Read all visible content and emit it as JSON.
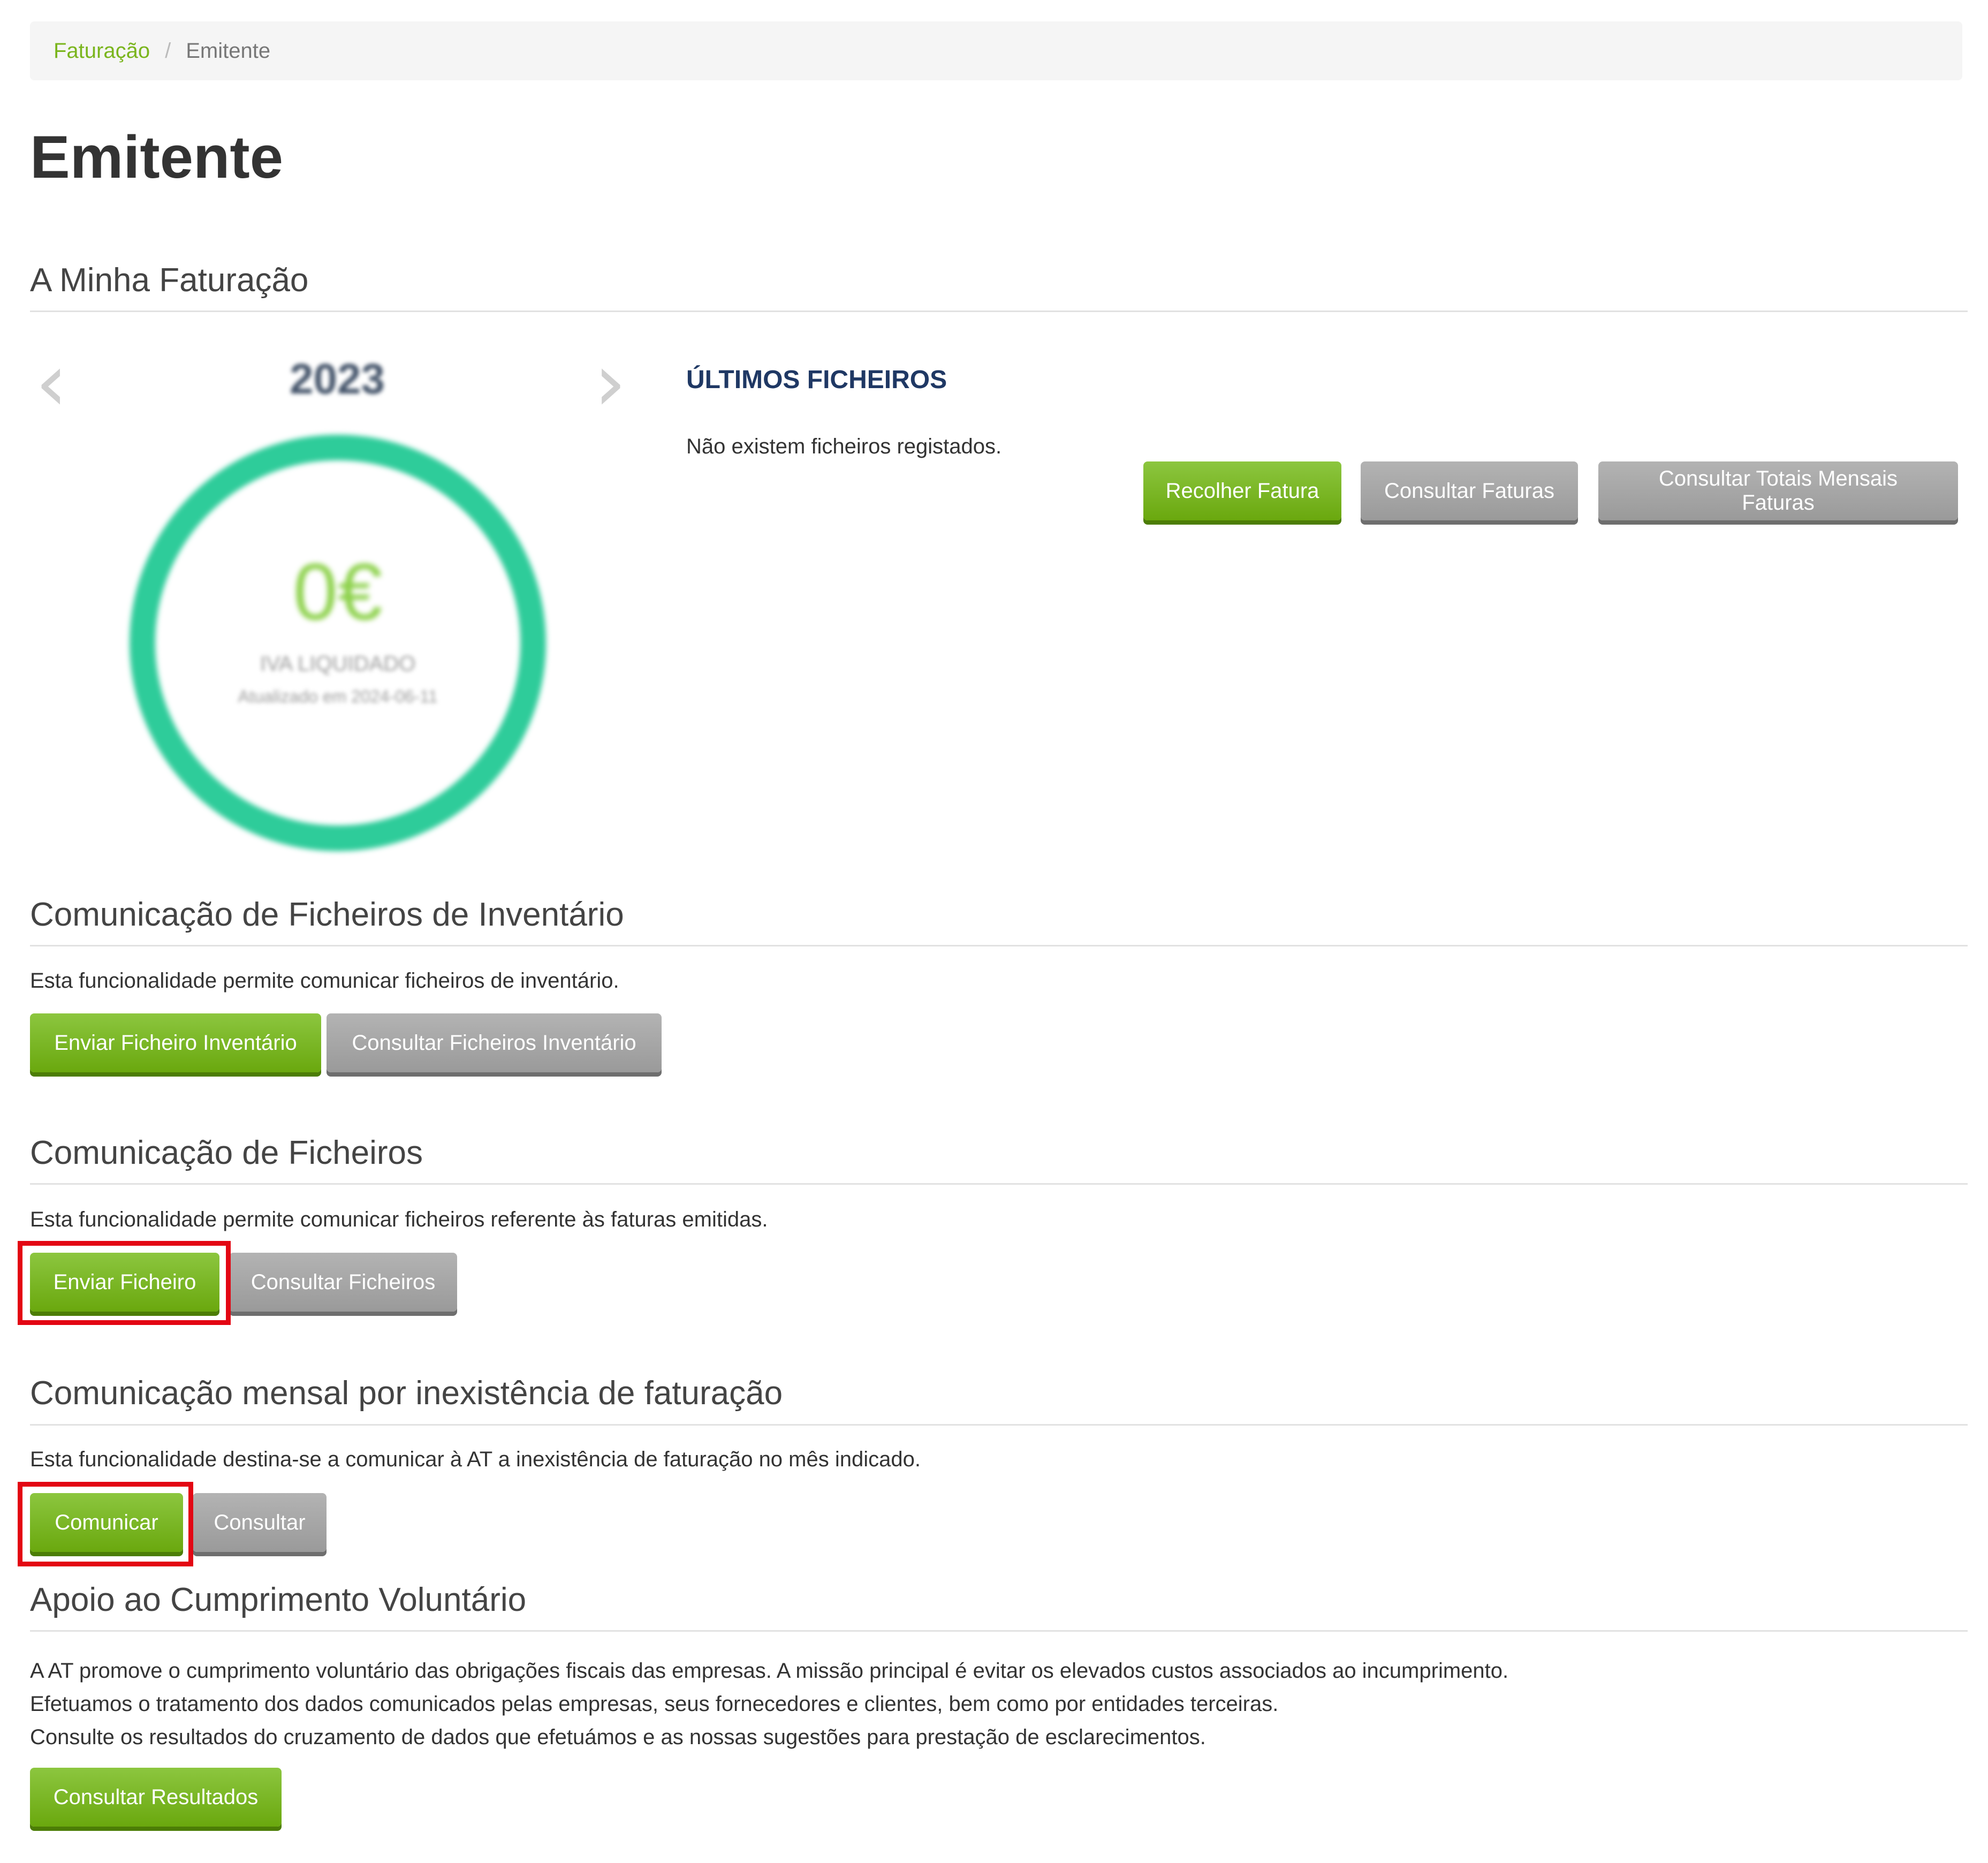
{
  "breadcrumb": {
    "link": "Faturação",
    "separator": "/",
    "current": "Emitente"
  },
  "page_title": "Emitente",
  "minha_faturacao": {
    "title": "A Minha Faturação",
    "year": "2023",
    "value": "0€",
    "label": "IVA LIQUIDADO",
    "updated": "Atualizado em 2024-06-11",
    "files_heading": "ÚLTIMOS FICHEIROS",
    "files_empty": "Não existem ficheiros registados.",
    "buttons": {
      "recolher": "Recolher Fatura",
      "consultar": "Consultar Faturas",
      "totais": "Consultar Totais Mensais Faturas"
    }
  },
  "inventario": {
    "title": "Comunicação de Ficheiros de Inventário",
    "description": "Esta funcionalidade permite comunicar ficheiros de inventário.",
    "buttons": {
      "enviar": "Enviar Ficheiro Inventário",
      "consultar": "Consultar Ficheiros Inventário"
    }
  },
  "ficheiros": {
    "title": "Comunicação de Ficheiros",
    "description": "Esta funcionalidade permite comunicar ficheiros referente às faturas emitidas.",
    "buttons": {
      "enviar": "Enviar Ficheiro",
      "consultar": "Consultar Ficheiros"
    }
  },
  "inexistencia": {
    "title": "Comunicação mensal por inexistência de faturação",
    "description": "Esta funcionalidade destina-se a comunicar à AT a inexistência de faturação no mês indicado.",
    "buttons": {
      "comunicar": "Comunicar",
      "consultar": "Consultar"
    }
  },
  "apoio": {
    "title": "Apoio ao Cumprimento Voluntário",
    "lines": [
      "A AT promove o cumprimento voluntário das obrigações fiscais das empresas. A missão principal é evitar os elevados custos associados ao incumprimento.",
      "Efetuamos o tratamento dos dados comunicados pelas empresas, seus fornecedores e clientes, bem como por entidades terceiras.",
      "Consulte os resultados do cruzamento de dados que efetuámos e as nossas sugestões para prestação de esclarecimentos."
    ],
    "button": "Consultar Resultados"
  },
  "colors": {
    "accent_green": "#7ab51d",
    "button_gray": "#a6a6a6",
    "ring": "#2ecc9a",
    "highlight": "#e30613"
  }
}
